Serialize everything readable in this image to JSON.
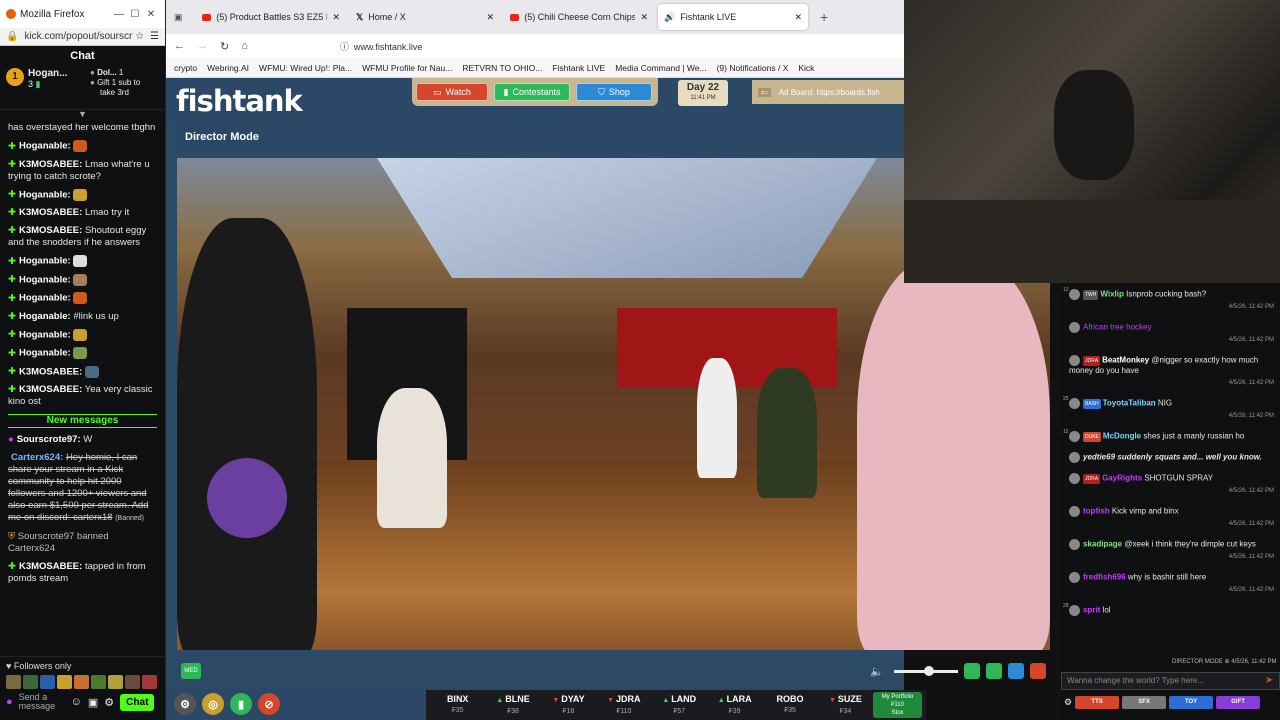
{
  "left": {
    "window_title": "Mozilla Firefox",
    "url": "kick.com/popout/sourscr",
    "chat_title": "Chat",
    "pinned": {
      "user1_name": "Hogan...",
      "user1_count": "3",
      "user2_name": "Dol...",
      "user2_count": "1",
      "gift_line1": "Gift 1 sub to",
      "gift_line2": "take 3rd"
    },
    "messages": [
      {
        "type": "text",
        "user": "",
        "text": "has overstayed her welcome tbghn"
      },
      {
        "type": "emote",
        "user": "Hoganable:",
        "text": ""
      },
      {
        "type": "text",
        "user": "K3MOSABEE:",
        "text": "Lmao what're u trying to catch scrote?"
      },
      {
        "type": "emote",
        "user": "Hoganable:",
        "text": ""
      },
      {
        "type": "text",
        "user": "K3MOSABEE:",
        "text": "Lmao try it"
      },
      {
        "type": "text",
        "user": "K3MOSABEE:",
        "text": "Shoutout eggy and the snodders if he answers"
      },
      {
        "type": "emote",
        "user": "Hoganable:",
        "text": ""
      },
      {
        "type": "emote",
        "user": "Hoganable:",
        "text": ""
      },
      {
        "type": "emote",
        "user": "Hoganable:",
        "text": ""
      },
      {
        "type": "text",
        "user": "Hoganable:",
        "text": "#link us up"
      },
      {
        "type": "emote",
        "user": "Hoganable:",
        "text": ""
      },
      {
        "type": "emote",
        "user": "Hoganable:",
        "text": ""
      },
      {
        "type": "emote",
        "user": "K3MOSABEE:",
        "text": ""
      },
      {
        "type": "text",
        "user": "K3MOSABEE:",
        "text": "Yea very classic kino ost"
      }
    ],
    "new_messages": "New messages",
    "after": [
      {
        "kind": "p",
        "user": "Sourscrote97:",
        "text": "W"
      },
      {
        "kind": "spam",
        "user": "Carterx624:",
        "text": "Hey homie, I can share your stream in a Kick community to help hit 2000 followers and 1200+ viewers and also earn $1,500 per stream. Add me on discord: carterx18",
        "suffix": "(Banned)"
      },
      {
        "kind": "ban",
        "text": "Sourscrote97 banned Carterx624"
      },
      {
        "kind": "g",
        "user": "K3MOSABEE:",
        "text": "tapped in from pomds stream"
      }
    ],
    "followers_only": "Followers only",
    "send_placeholder": "Send a message",
    "chat_button": "Chat"
  },
  "browser": {
    "tabs": [
      {
        "label": "(5) Product Battles S3 EZ5 Battl",
        "icon": "youtube-icon",
        "active": false
      },
      {
        "label": "Home / X",
        "icon": "x-icon",
        "active": false
      },
      {
        "label": "(5) Chili Cheese Corn Chips Batt",
        "icon": "youtube-icon",
        "active": false
      },
      {
        "label": "Fishtank LIVE",
        "icon": "speaker-icon",
        "active": true
      }
    ],
    "url": "www.fishtank.live",
    "bookmarks": [
      "crypto",
      "Webring.AI",
      "WFMU: Wired Up!: Pla...",
      "WFMU Profile for Nau...",
      "RETVRN TO OHIO...",
      "Fishtank LIVE",
      "Media Command | We...",
      "(9) Notifications / X",
      "Kick"
    ]
  },
  "fishtank": {
    "logo": "fishtank",
    "nav": {
      "watch": "Watch",
      "contestants": "Contestants",
      "shop": "Shop"
    },
    "day": "Day 22",
    "time": "11:41 PM",
    "adboard": "Ad Board: https://boards.fish",
    "director_mode": "Director Mode",
    "med_badge": "MED",
    "stocks": [
      {
        "name": "BINX",
        "price": "₣35",
        "dir": "none"
      },
      {
        "name": "BLNE",
        "price": "₣38",
        "dir": "up"
      },
      {
        "name": "DYAY",
        "price": "₣18",
        "dir": "down"
      },
      {
        "name": "JDRA",
        "price": "₣110",
        "dir": "down"
      },
      {
        "name": "LAND",
        "price": "₣57",
        "dir": "up"
      },
      {
        "name": "LARA",
        "price": "₣39",
        "dir": "up"
      },
      {
        "name": "ROBO",
        "price": "₣35",
        "dir": "none"
      },
      {
        "name": "SUZE",
        "price": "₣34",
        "dir": "down"
      }
    ],
    "portfolio": {
      "title": "My Portfolio",
      "value": "₣110",
      "label": "Stox"
    },
    "volume_level": 0.55
  },
  "right_chat": {
    "messages": [
      {
        "level": "12",
        "tag": "TWH",
        "tagc": "#555",
        "user": "Wixlip",
        "ucolor": "#7fe37f",
        "text": "Isnprob cucking bash?",
        "ts": "4/5/26, 11:42 PM"
      },
      {
        "level": "",
        "tag": "",
        "tagc": "",
        "user": "",
        "ucolor": "#c23cff",
        "text": "African tree hockey",
        "ts": "4/5/26, 11:42 PM"
      },
      {
        "level": "",
        "tag": "JDRA",
        "tagc": "#b51e1e",
        "user": "BeatMonkey",
        "ucolor": "#fff",
        "text": "@nigger so exactly how much money do you have",
        "ts": "4/5/26, 11:42 PM"
      },
      {
        "level": "25",
        "tag": "BASH",
        "tagc": "#2b6fd6",
        "user": "ToyotaTaliban",
        "ucolor": "#7ad8ff",
        "text": "NIG",
        "ts": "4/5/26, 11:42 PM"
      },
      {
        "level": "15",
        "tag": "DUKE",
        "tagc": "#d6462b",
        "user": "McDongle",
        "ucolor": "#7ad8ff",
        "text": "shes just a manly russian ho",
        "ts": ""
      },
      {
        "level": "",
        "tag": "",
        "tagc": "",
        "user": "",
        "ucolor": "#fff",
        "text": "yedtie69 suddenly squats and... well you know.",
        "ts": ""
      },
      {
        "level": "",
        "tag": "JDRA",
        "tagc": "#b51e1e",
        "user": "GayRights",
        "ucolor": "#c23cff",
        "text": "SHOTGUN SPRAY",
        "ts": "4/5/26, 11:42 PM"
      },
      {
        "level": "",
        "tag": "",
        "tagc": "",
        "user": "topfish",
        "ucolor": "#c23cff",
        "text": "Kick vimp and binx",
        "ts": "4/5/26, 11:42 PM"
      },
      {
        "level": "",
        "tag": "",
        "tagc": "",
        "user": "skadipage",
        "ucolor": "#7fe37f",
        "text": "@xeek i think they're dimple cut keys",
        "ts": "4/5/26, 11:42 PM"
      },
      {
        "level": "",
        "tag": "",
        "tagc": "",
        "user": "fredfish696",
        "ucolor": "#c23cff",
        "text": "why is bashir still here",
        "ts": "4/5/26, 11:42 PM"
      },
      {
        "level": "28",
        "tag": "",
        "tagc": "",
        "user": "sprit",
        "ucolor": "#c23cff",
        "text": "lol",
        "ts": ""
      }
    ],
    "last_ts": "DIRECTOR MODE ⊕ 4/5/26, 11:42 PM",
    "input_placeholder": "Wanna change the world? Type here...",
    "buttons": [
      {
        "label": "TTS",
        "color": "#d6462b"
      },
      {
        "label": "SFX",
        "color": "#777"
      },
      {
        "label": "TOY",
        "color": "#2b6fd6"
      },
      {
        "label": "GIFT",
        "color": "#8a3cd6"
      }
    ]
  }
}
